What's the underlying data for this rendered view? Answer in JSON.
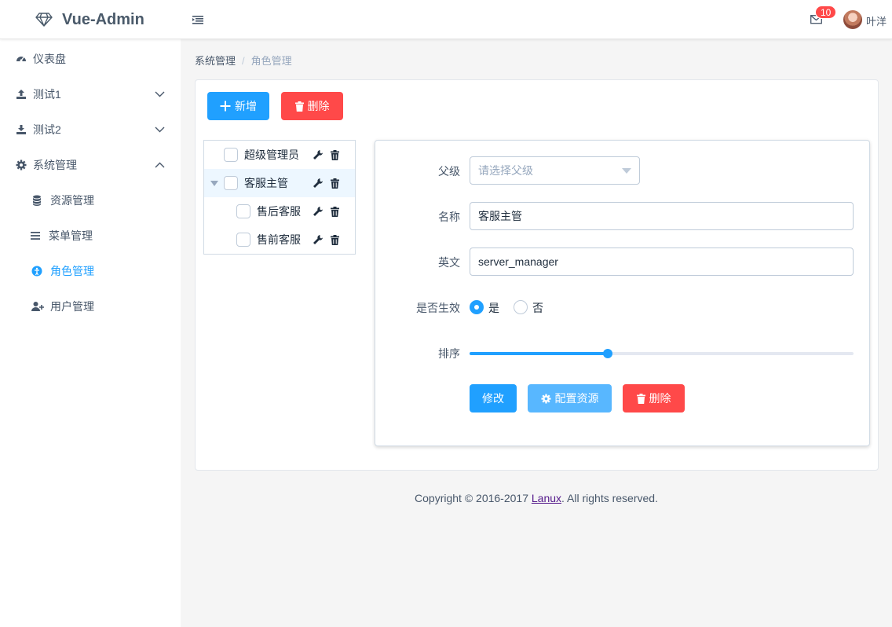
{
  "header": {
    "app_title": "Vue-Admin",
    "mail_badge": "10",
    "username": "叶洋"
  },
  "sidebar": {
    "items": [
      {
        "label": "仪表盘",
        "icon": "dashboard-icon"
      },
      {
        "label": "测试1",
        "icon": "upload-icon",
        "expanded": false
      },
      {
        "label": "测试2",
        "icon": "download-icon",
        "expanded": false
      },
      {
        "label": "系统管理",
        "icon": "gear-icon",
        "expanded": true
      },
      {
        "label": "资源管理",
        "icon": "database-icon"
      },
      {
        "label": "菜单管理",
        "icon": "list-icon"
      },
      {
        "label": "角色管理",
        "icon": "role-icon",
        "active": true
      },
      {
        "label": "用户管理",
        "icon": "user-add-icon"
      }
    ]
  },
  "breadcrumb": {
    "items": [
      "系统管理",
      "角色管理"
    ],
    "separator": "/"
  },
  "toolbar": {
    "add_label": "新增",
    "delete_label": "删除"
  },
  "tree": {
    "nodes": [
      {
        "label": "超级管理员",
        "level": 0
      },
      {
        "label": "客服主管",
        "level": 0,
        "expanded": true,
        "current": true
      },
      {
        "label": "售后客服",
        "level": 1
      },
      {
        "label": "售前客服",
        "level": 1
      }
    ]
  },
  "form": {
    "parent_label": "父级",
    "parent_placeholder": "请选择父级",
    "name_label": "名称",
    "name_value": "客服主管",
    "english_label": "英文",
    "english_value": "server_manager",
    "enabled_label": "是否生效",
    "enabled_yes": "是",
    "enabled_no": "否",
    "enabled_value": "是",
    "sort_label": "排序",
    "sort_fraction": 0.36,
    "update_label": "修改",
    "config_label": "配置资源",
    "delete_label": "删除"
  },
  "footer": {
    "prefix": "Copyright © 2016-2017 ",
    "link": "Lanux",
    "suffix": ". All rights reserved."
  },
  "colors": {
    "primary": "#20a0ff",
    "danger": "#ff4949",
    "primary_light": "#58b7ff"
  }
}
